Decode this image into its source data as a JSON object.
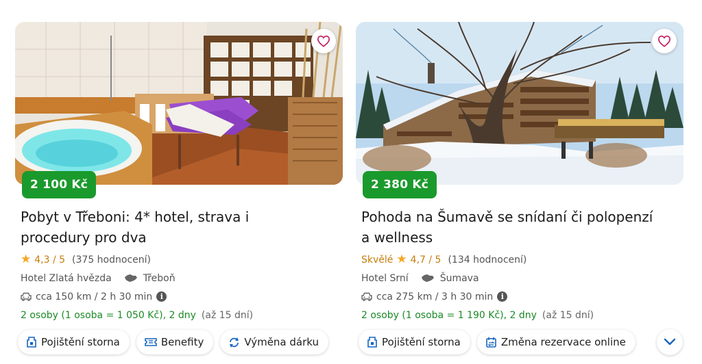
{
  "cards": [
    {
      "price": "2 100 Kč",
      "title": "Pobyt v Třeboni: 4* hotel, strava i procedury pro dva",
      "rating_word": "",
      "rating": "4,3 / 5",
      "reviews": "(375 hodnocení)",
      "hotel": "Hotel Zlatá hvězda",
      "region": "Třeboň",
      "distance": "cca 150 km / 2 h 30 min",
      "persons": "2 osoby (1 osoba = 1 050 Kč), 2 dny",
      "validity": "(až 15 dní)",
      "chips": [
        {
          "label": "Pojištění storna",
          "icon": "insurance-icon"
        },
        {
          "label": "Benefity",
          "icon": "ticket-icon"
        },
        {
          "label": "Výměna dárku",
          "icon": "exchange-icon"
        }
      ]
    },
    {
      "price": "2 380 Kč",
      "title": "Pohoda na Šumavě se snídaní či polopenzí a wellness",
      "rating_word": "Skvělé",
      "rating": "4,7 / 5",
      "reviews": "(134 hodnocení)",
      "hotel": "Hotel Srní",
      "region": "Šumava",
      "distance": "cca 275 km / 3 h 30 min",
      "persons": "2 osoby (1 osoba = 1 190 Kč), 2 dny",
      "validity": "(až 15 dní)",
      "chips": [
        {
          "label": "Pojištění storna",
          "icon": "insurance-icon"
        },
        {
          "label": "Změna rezervace online",
          "icon": "calendar-swap-icon"
        }
      ]
    }
  ],
  "colors": {
    "price_badge": "#1a9a2c",
    "rating": "#c67d0b",
    "star": "#f5a623",
    "persons": "#1a8a26",
    "accent": "#1565c0"
  },
  "icons": {
    "favorite": "heart-icon",
    "scroll": "chevron-down-icon",
    "star": "star-icon",
    "map": "czech-map-icon",
    "car": "car-icon",
    "info": "info-icon"
  }
}
